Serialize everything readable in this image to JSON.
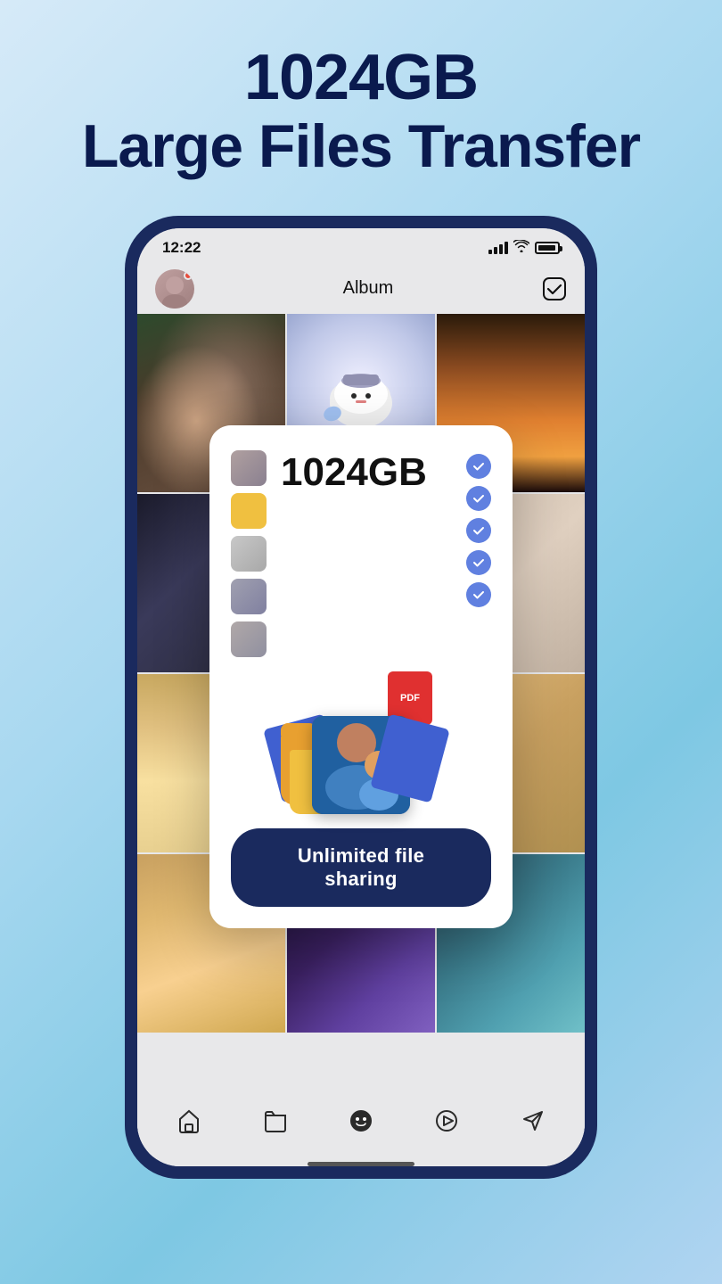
{
  "header": {
    "title_line1": "1024GB",
    "title_line2": "Large Files Transfer"
  },
  "phone": {
    "status_bar": {
      "time": "12:22",
      "signal": "signal",
      "wifi": "wifi",
      "battery": "battery"
    },
    "app_bar": {
      "album_title": "Album",
      "avatar_alt": "user avatar",
      "notification_dot": true
    },
    "popup": {
      "size_label": "1024GB",
      "button_label": "Unlimited file sharing",
      "checkmarks_count": 5
    },
    "nav_bar": {
      "items": [
        {
          "icon": "home-icon",
          "label": "Home"
        },
        {
          "icon": "folder-icon",
          "label": "Files"
        },
        {
          "icon": "sticker-icon",
          "label": "Stickers"
        },
        {
          "icon": "play-icon",
          "label": "Play"
        },
        {
          "icon": "send-icon",
          "label": "Send"
        }
      ]
    }
  }
}
